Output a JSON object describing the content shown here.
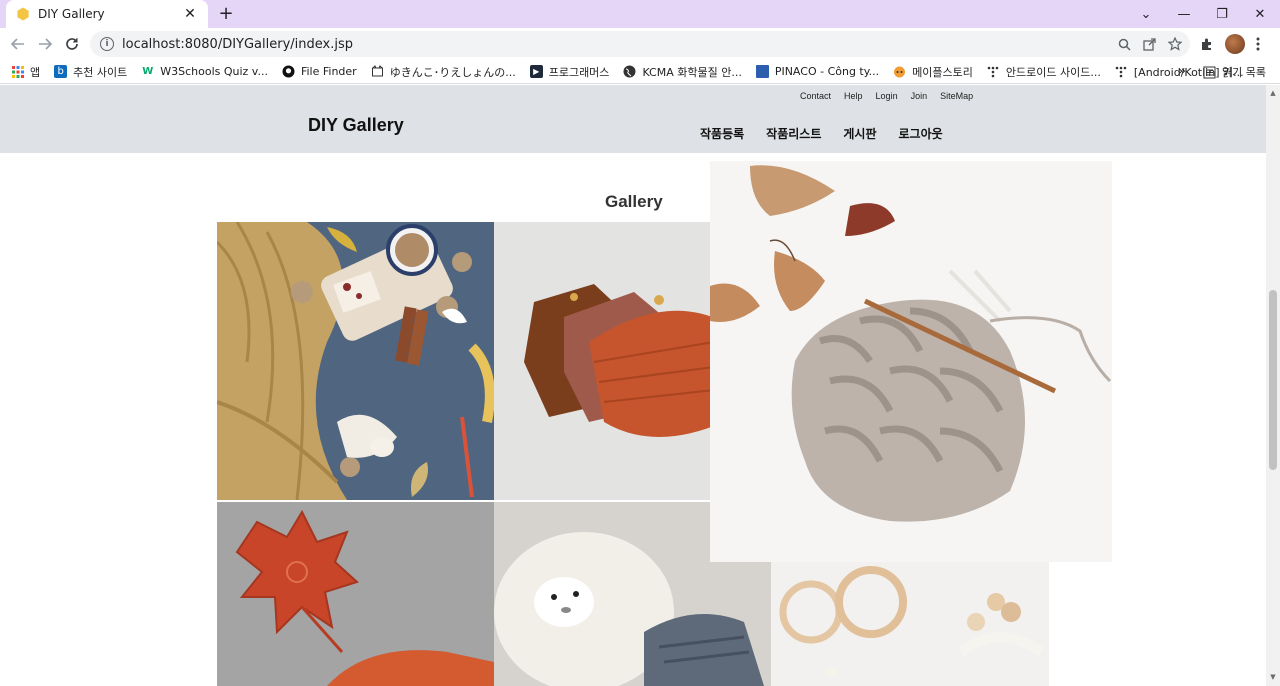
{
  "browser": {
    "tab_title": "DIY Gallery",
    "tab_close": "✕",
    "new_tab": "+",
    "url": "localhost:8080/DIYGallery/index.jsp",
    "window_controls": {
      "dropdown": "⌄",
      "minimize": "—",
      "restore": "❐",
      "close": "✕"
    },
    "bookmarks": [
      {
        "label": "앱",
        "icon": "apps-grid-icon"
      },
      {
        "label": "추천 사이트",
        "icon": "bing-icon"
      },
      {
        "label": "W3Schools Quiz v...",
        "icon": "w3schools-icon"
      },
      {
        "label": "File Finder",
        "icon": "github-icon"
      },
      {
        "label": "ゆきんこ･りえしょんの...",
        "icon": "cat-icon"
      },
      {
        "label": "프로그래머스",
        "icon": "programmers-icon"
      },
      {
        "label": "KCMA 화학물질 안...",
        "icon": "globe-icon"
      },
      {
        "label": "PINACO - Công ty...",
        "icon": "pinaco-icon"
      },
      {
        "label": "메이플스토리",
        "icon": "maplestory-icon"
      },
      {
        "label": "안드로이드 사이드...",
        "icon": "dots-icon"
      },
      {
        "label": "[Android/Kotlin] 커...",
        "icon": "dots-icon"
      }
    ],
    "bookmarks_more": "»",
    "reading_list": "읽기 목록"
  },
  "site": {
    "util_nav": [
      "Contact",
      "Help",
      "Login",
      "Join",
      "SiteMap"
    ],
    "logo": "DIY Gallery",
    "main_nav": [
      "작품등록",
      "작품리스트",
      "게시판",
      "로그아웃"
    ],
    "gallery_title": "Gallery"
  },
  "colors": {
    "tabstrip": "#e5d5f7",
    "header_bg": "#dee1e5"
  }
}
